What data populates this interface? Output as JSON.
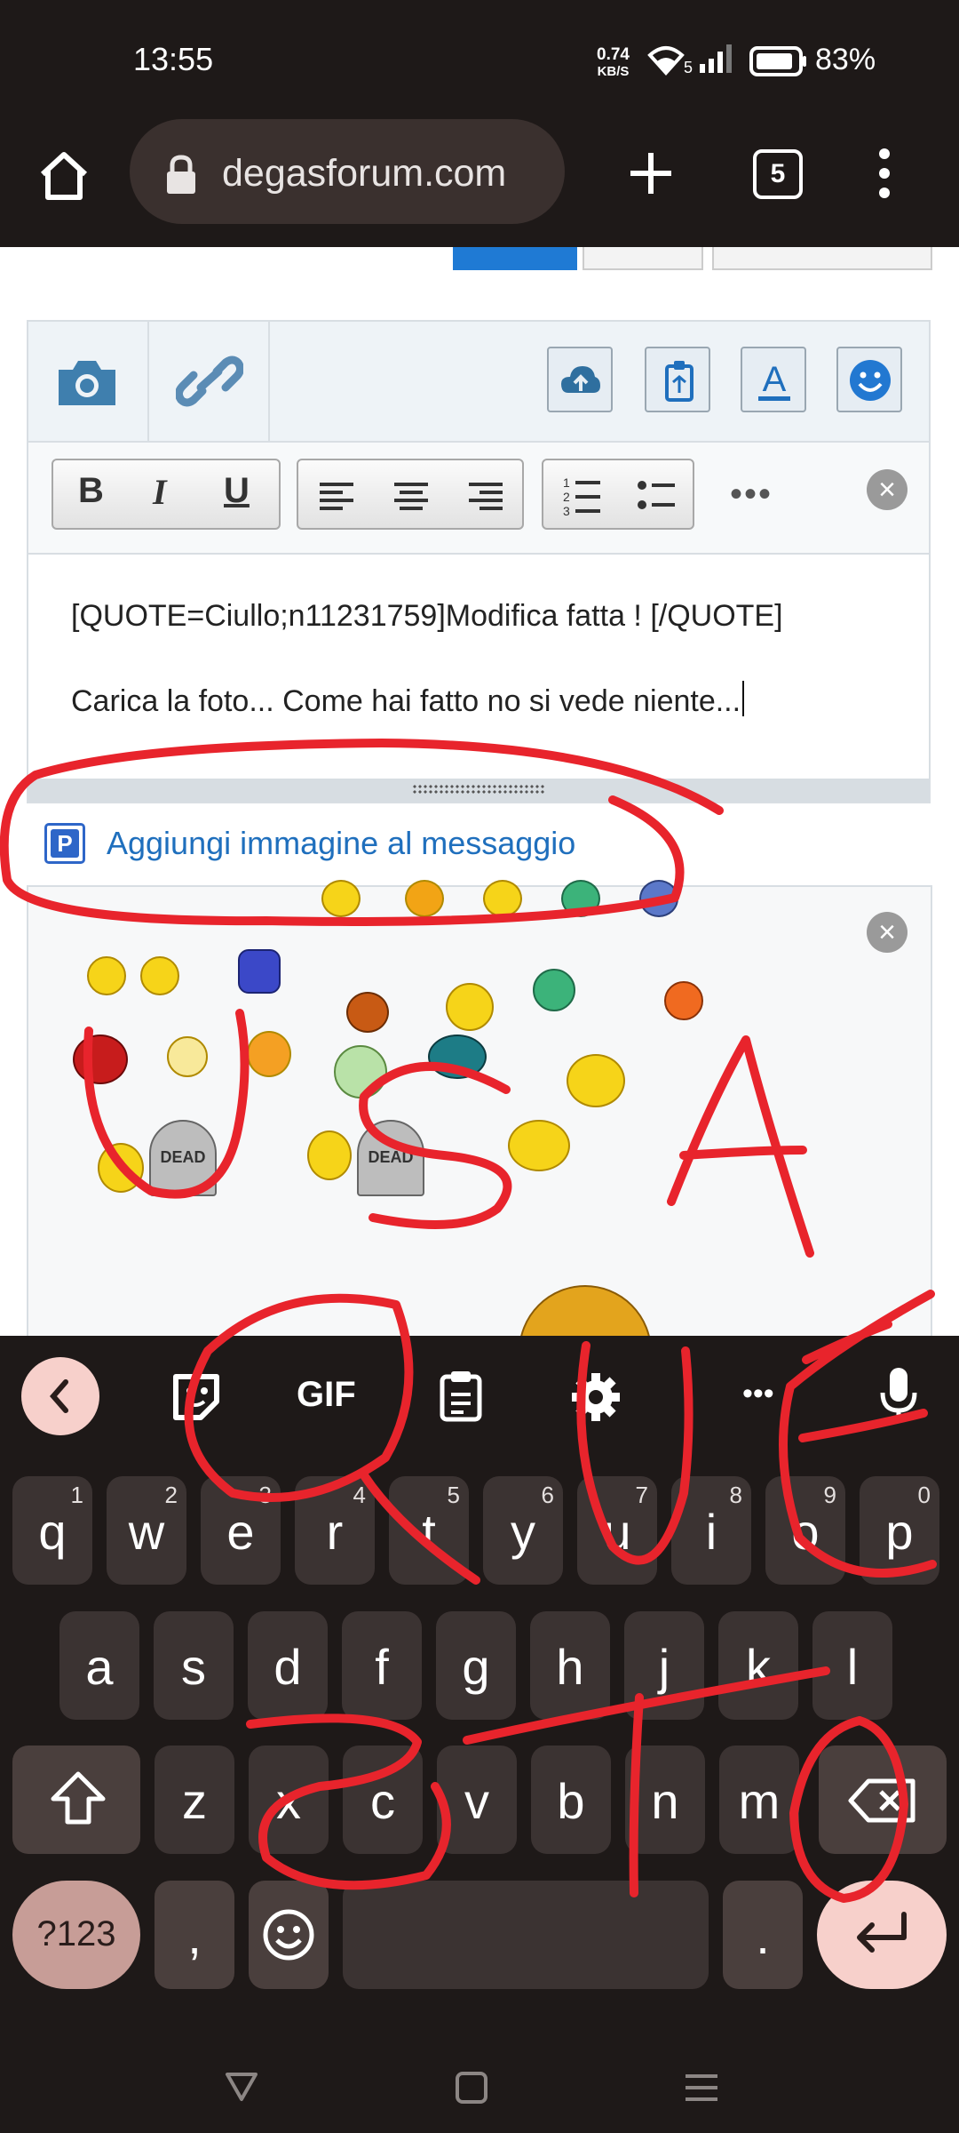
{
  "status_bar": {
    "time": "13:55",
    "net_speed_value": "0.74",
    "net_speed_unit": "KB/S",
    "wifi_badge": "5",
    "battery": "83%"
  },
  "browser": {
    "url": "degasforum.com",
    "tab_count": "5",
    "icons": [
      "home-icon",
      "lock-icon",
      "new-tab-icon",
      "tab-switcher-icon",
      "menu-icon"
    ]
  },
  "editor": {
    "toolbar_icons": [
      "camera-icon",
      "link-icon",
      "cloud-upload-icon",
      "clipboard-icon",
      "text-color-icon",
      "smiley-icon"
    ],
    "format_buttons": {
      "bold": "B",
      "italic": "I",
      "underline": "U",
      "more": "•••"
    },
    "content_line1": "[QUOTE=Ciullo;n11231759]Modifica fatta ! [/QUOTE]",
    "content_line2": "Carica la foto... Come hai fatto no si vede niente..."
  },
  "add_image": {
    "badge": "P",
    "label": "Aggiungi immagine al messaggio"
  },
  "smilies": {
    "tomb_label": "DEAD",
    "close_glyph": "×"
  },
  "keyboard": {
    "toolbar": {
      "gif_label": "GIF",
      "more": "•••"
    },
    "row1": [
      {
        "k": "q",
        "n": "1"
      },
      {
        "k": "w",
        "n": "2"
      },
      {
        "k": "e",
        "n": "3"
      },
      {
        "k": "r",
        "n": "4"
      },
      {
        "k": "t",
        "n": "5"
      },
      {
        "k": "y",
        "n": "6"
      },
      {
        "k": "u",
        "n": "7"
      },
      {
        "k": "i",
        "n": "8"
      },
      {
        "k": "o",
        "n": "9"
      },
      {
        "k": "p",
        "n": "0"
      }
    ],
    "row2": [
      "a",
      "s",
      "d",
      "f",
      "g",
      "h",
      "j",
      "k",
      "l"
    ],
    "row3": [
      "z",
      "x",
      "c",
      "v",
      "b",
      "n",
      "m"
    ],
    "symbols_label": "?123",
    "comma": ",",
    "period": "."
  },
  "annotation_text": [
    "USA",
    "QUESTO"
  ],
  "colors": {
    "accent_blue": "#1f6fbd",
    "annotation_red": "#e8242c",
    "keyboard_bg": "#1e1918",
    "key_bg": "#3b3332",
    "action_key": "#f7d0cb"
  }
}
